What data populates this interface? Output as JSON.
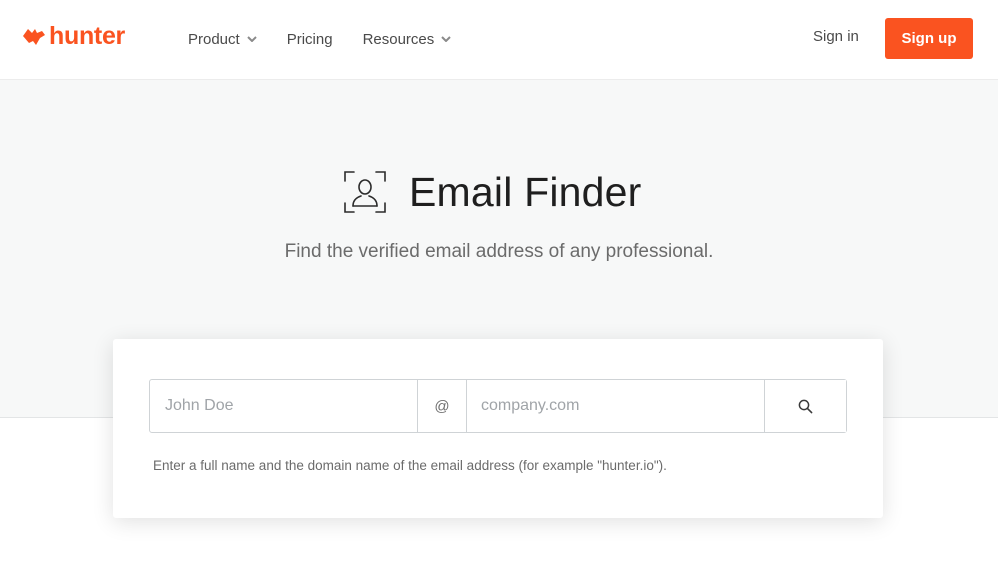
{
  "header": {
    "logo_text": "hunter",
    "nav": [
      {
        "label": "Product",
        "has_dropdown": true
      },
      {
        "label": "Pricing",
        "has_dropdown": false
      },
      {
        "label": "Resources",
        "has_dropdown": true
      }
    ],
    "signin_label": "Sign in",
    "signup_label": "Sign up"
  },
  "hero": {
    "title": "Email Finder",
    "subtitle": "Find the verified email address of any professional.",
    "icon": "person-scan-icon"
  },
  "search": {
    "name_placeholder": "John Doe",
    "name_value": "",
    "at_symbol": "@",
    "domain_placeholder": "company.com",
    "domain_value": "",
    "search_icon": "search-icon",
    "helper_text": "Enter a full name and the domain name of the email address (for example \"hunter.io\")."
  },
  "colors": {
    "brand": "#fa5320",
    "hero_background": "#f7f8f8",
    "text_primary": "#1f1f1f",
    "text_muted": "#6b6b6b"
  }
}
